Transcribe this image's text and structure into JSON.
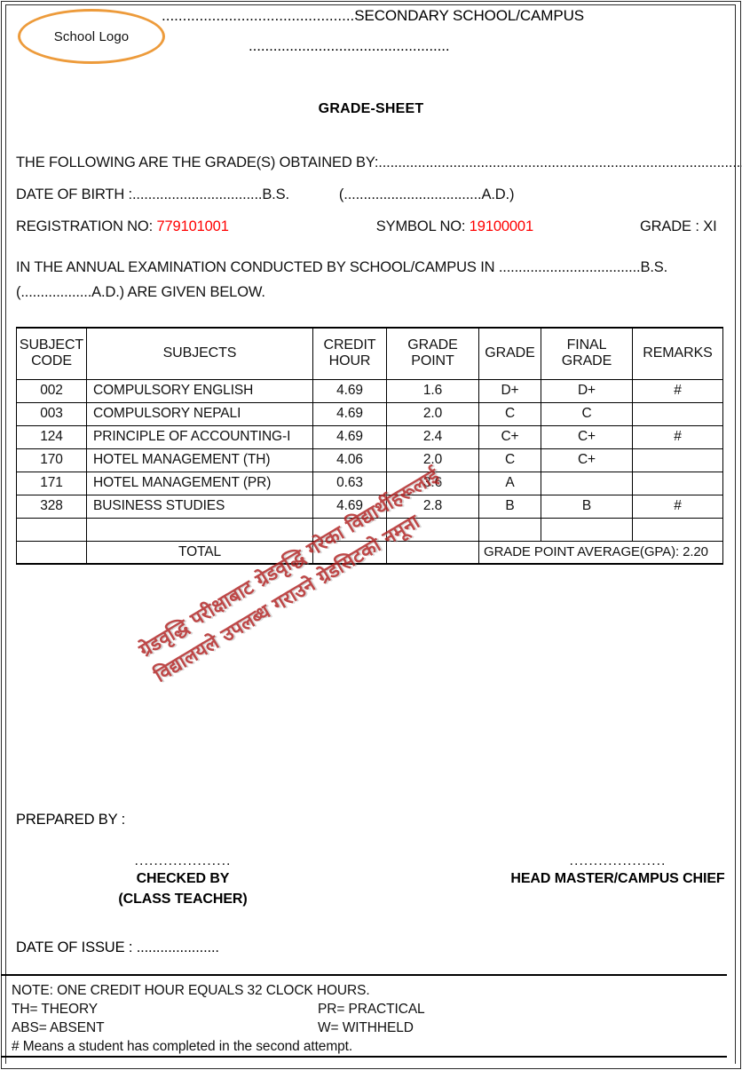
{
  "document": {
    "logo_text": "School Logo",
    "school_line_dots": "..............................................",
    "school_line_text": "SECONDARY SCHOOL/CAMPUS",
    "school_line2_dots": ".................................................",
    "title": "GRADE-SHEET"
  },
  "info": {
    "following_label": "THE FOLLOWING ARE THE GRADE(S) OBTAINED BY:",
    "following_dots": "................................................................................................",
    "dob_label": "DATE OF BIRTH :",
    "dob_dots": ".................................",
    "dob_bs": "B.S.",
    "dob_ad_open": "(",
    "dob_ad_dots": "...................................",
    "dob_ad": "A.D.)",
    "registration_label": "REGISTRATION NO:",
    "registration_value": "779101001",
    "symbol_label": "SYMBOL NO:",
    "symbol_value": "19100001",
    "grade_label": "GRADE : XI",
    "annual_line1_a": "IN THE ANNUAL EXAMINATION CONDUCTED BY SCHOOL/CAMPUS IN",
    "annual_line1_dots": "....................................",
    "annual_line1_b": "B.S.",
    "annual_line2_a": "(..................",
    "annual_line2_b": "A.D.) ARE GIVEN BELOW."
  },
  "table": {
    "headers": {
      "code": "SUBJECT\nCODE",
      "code_l1": "SUBJECT",
      "code_l2": "CODE",
      "subjects": "SUBJECTS",
      "credit_l1": "CREDIT",
      "credit_l2": "HOUR",
      "gp_l1": "GRADE",
      "gp_l2": "POINT",
      "grade": "GRADE",
      "final_l1": "FINAL",
      "final_l2": "GRADE",
      "remarks": "REMARKS"
    },
    "rows": [
      {
        "code": "002",
        "subject": "COMPULSORY ENGLISH",
        "credit": "4.69",
        "gp": "1.6",
        "grade": "D+",
        "final": "D+",
        "remarks": "#"
      },
      {
        "code": "003",
        "subject": "COMPULSORY NEPALI",
        "credit": "4.69",
        "gp": "2.0",
        "grade": "C",
        "final": "C",
        "remarks": ""
      },
      {
        "code": "124",
        "subject": "PRINCIPLE OF ACCOUNTING-I",
        "credit": "4.69",
        "gp": "2.4",
        "grade": "C+",
        "final": "C+",
        "remarks": "#"
      },
      {
        "code": "170",
        "subject": "HOTEL MANAGEMENT (TH)",
        "credit": "4.06",
        "gp": "2.0",
        "grade": "C",
        "final": "C+",
        "remarks": ""
      },
      {
        "code": "171",
        "subject": "HOTEL MANAGEMENT (PR)",
        "credit": "0.63",
        "gp": "3.6",
        "grade": "A",
        "final": "",
        "remarks": ""
      },
      {
        "code": "328",
        "subject": "BUSINESS STUDIES",
        "credit": "4.69",
        "gp": "2.8",
        "grade": "B",
        "final": "B",
        "remarks": "#"
      }
    ],
    "total_label": "TOTAL",
    "gpa_text": "GRADE POINT AVERAGE(GPA): 2.20"
  },
  "watermark": {
    "line1": "ग्रेडवृद्धि परीक्षाबाट ग्रेडवृद्धि गरेका विद्यार्थीहरूलाई",
    "line2": "विद्यालयले उपलब्ध गराउने ग्रेडसिटको नमूना",
    "color": "#B02020"
  },
  "signatures": {
    "prepared_by": "PREPARED BY :",
    "left_dots": "....................",
    "left_label_l1": "CHECKED BY",
    "left_label_l2": "(CLASS TEACHER)",
    "right_dots": "....................",
    "right_label": "HEAD MASTER/CAMPUS CHIEF",
    "date_of_issue": "DATE OF ISSUE : ....................."
  },
  "notes": {
    "line1": "NOTE: ONE CREDIT HOUR EQUALS 32 CLOCK HOURS.",
    "line2_a": "TH= THEORY",
    "line2_b": "PR= PRACTICAL",
    "line3_a": "ABS= ABSENT",
    "line3_b": "W= WITHHELD",
    "line4": "# Means a student has completed in the second attempt."
  },
  "colors": {
    "accent_orange": "#ED9B3B",
    "red_value": "#FF0000",
    "watermark_red": "#B02020"
  }
}
